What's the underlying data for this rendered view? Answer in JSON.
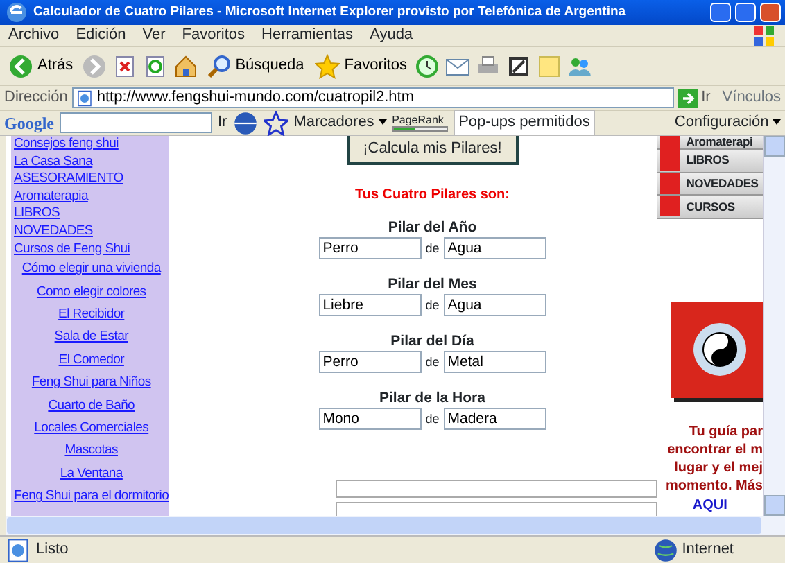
{
  "window": {
    "title": "Calculador de Cuatro Pilares - Microsoft Internet Explorer provisto por Telefónica de Argentina"
  },
  "menu": [
    "Archivo",
    "Edición",
    "Ver",
    "Favoritos",
    "Herramientas",
    "Ayuda"
  ],
  "toolbar": [
    {
      "kind": "back",
      "label": "Atrás"
    },
    {
      "kind": "forward"
    },
    {
      "kind": "stop"
    },
    {
      "kind": "refresh"
    },
    {
      "kind": "home"
    },
    {
      "kind": "search",
      "label": "Búsqueda"
    },
    {
      "kind": "favorites",
      "label": "Favoritos"
    },
    {
      "kind": "history"
    },
    {
      "kind": "mail"
    },
    {
      "kind": "print"
    },
    {
      "kind": "edit"
    },
    {
      "kind": "note"
    },
    {
      "kind": "messenger"
    }
  ],
  "address_bar": {
    "label": "Dirección",
    "url": "http://www.fengshui-mundo.com/cuatropil2.htm",
    "go": "Ir",
    "links": "Vínculos"
  },
  "google_bar": {
    "logo": "Google",
    "go": "Ir",
    "bookmarks": "Marcadores",
    "pagerank": "PageRank",
    "popups": "Pop-ups permitidos",
    "settings": "Configuración"
  },
  "sidebar": {
    "items": [
      {
        "label": "Consejos feng shui",
        "centered": false
      },
      {
        "label": "La Casa Sana",
        "centered": false
      },
      {
        "label": "ASESORAMIENTO",
        "centered": false
      },
      {
        "label": "Aromaterapia",
        "centered": false
      },
      {
        "label": "LIBROS",
        "centered": false
      },
      {
        "label": "NOVEDADES",
        "centered": false
      },
      {
        "label": "Cursos de Feng Shui",
        "centered": false
      },
      {
        "label": "Cómo elegir una vivienda",
        "centered": true
      },
      {
        "label": "Como elegir colores",
        "centered": true
      },
      {
        "label": "El Recibidor",
        "centered": true
      },
      {
        "label": "Sala de Estar",
        "centered": true
      },
      {
        "label": "El Comedor",
        "centered": true
      },
      {
        "label": "Feng Shui para Niños",
        "centered": true
      },
      {
        "label": "Cuarto de Baño",
        "centered": true
      },
      {
        "label": "Locales Comerciales",
        "centered": true
      },
      {
        "label": "Mascotas",
        "centered": true
      },
      {
        "label": "La Ventana",
        "centered": true
      },
      {
        "label": "Feng Shui para el dormitorio",
        "centered": true
      }
    ]
  },
  "calc_button": "¡Calcula mis Pilares!",
  "result_heading": "Tus Cuatro Pilares son:",
  "pillars": [
    {
      "title": "Pilar del Año",
      "animal": "Perro",
      "joiner": "de",
      "element": "Agua"
    },
    {
      "title": "Pilar del Mes",
      "animal": "Liebre",
      "joiner": "de",
      "element": "Agua"
    },
    {
      "title": "Pilar  del Día",
      "animal": "Perro",
      "joiner": "de",
      "element": "Metal"
    },
    {
      "title": "Pilar de la Hora",
      "animal": "Mono",
      "joiner": "de",
      "element": "Madera"
    }
  ],
  "right_menu": [
    "Aromaterapi",
    "LIBROS",
    "NOVEDADES",
    "CURSOS"
  ],
  "promo": {
    "lines": [
      "Tu guía par",
      "encontrar el m",
      "lugar y el mej",
      "momento. Más"
    ],
    "link": "AQUI"
  },
  "status_bar": {
    "text": "Listo",
    "zone": "Internet"
  }
}
